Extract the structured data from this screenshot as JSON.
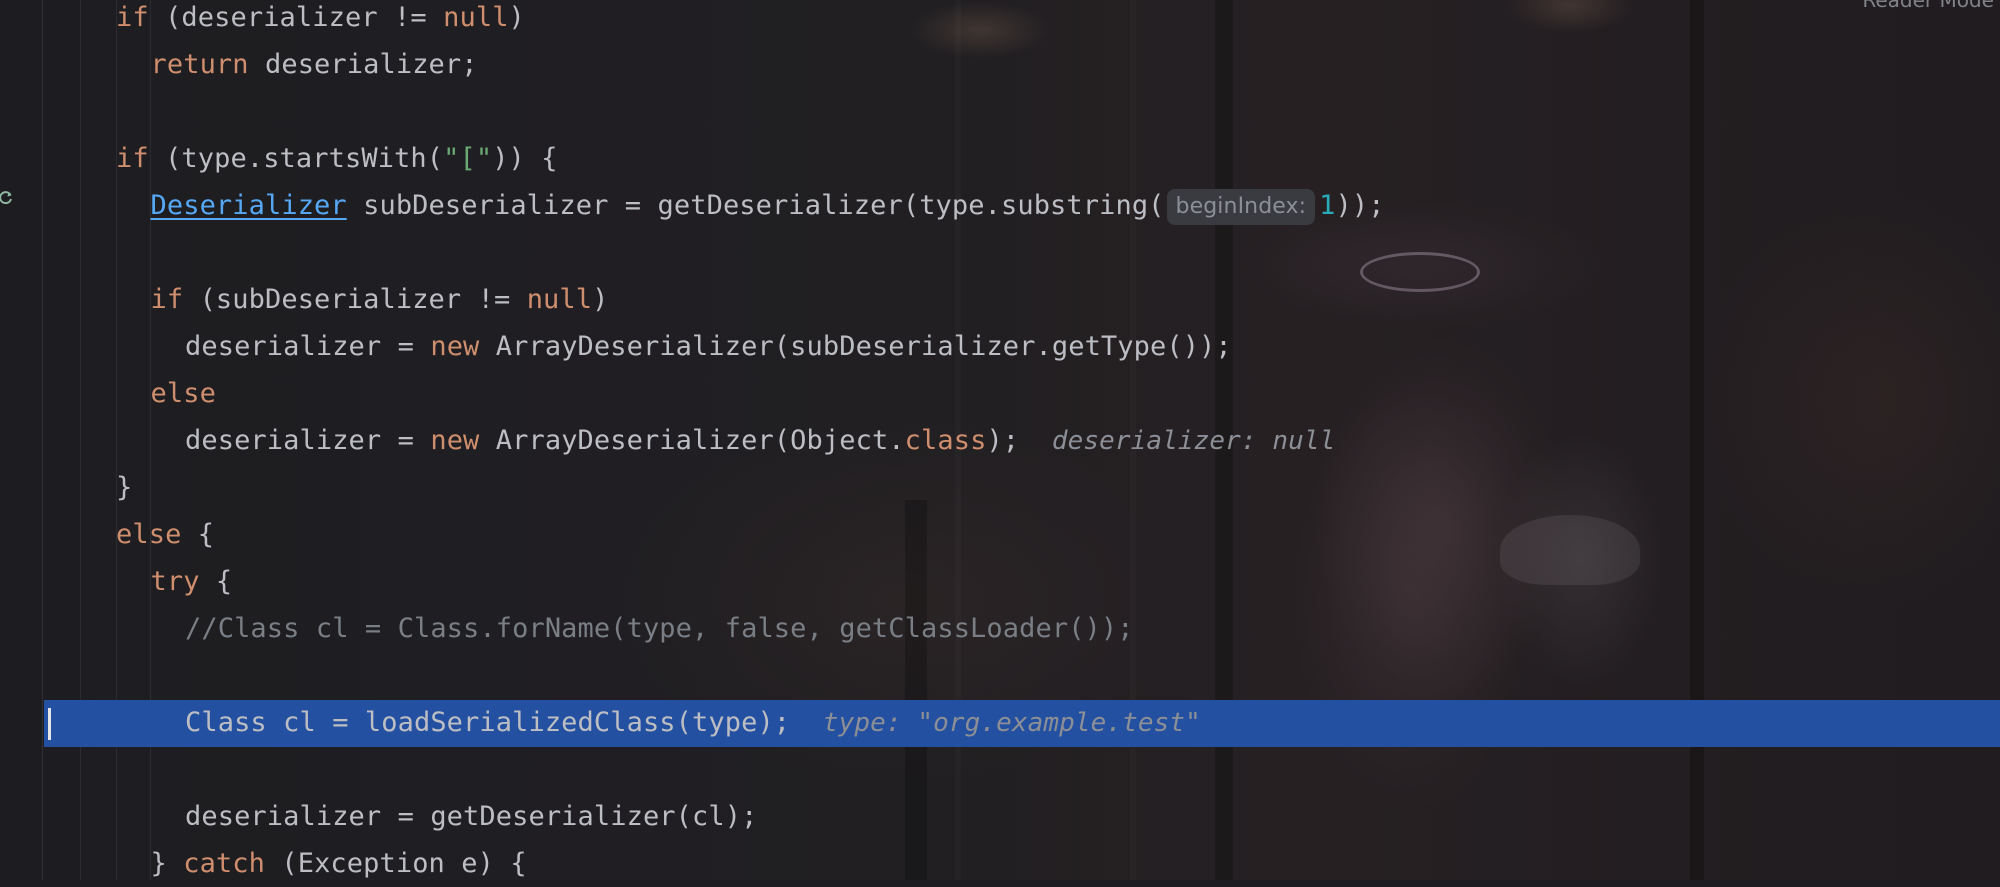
{
  "editor": {
    "corner_text": "Reader Mode",
    "lines": [
      {
        "indent": 0,
        "parts": [
          [
            "kw",
            "if"
          ],
          [
            "txt",
            " (deserializer != "
          ],
          [
            "kw",
            "null"
          ],
          [
            "txt",
            ")"
          ]
        ]
      },
      {
        "indent": 1,
        "parts": [
          [
            "kw",
            "return"
          ],
          [
            "txt",
            " deserializer;"
          ]
        ]
      },
      {
        "indent": 0,
        "parts": []
      },
      {
        "indent": 0,
        "parts": [
          [
            "kw",
            "if"
          ],
          [
            "txt",
            " (type.startsWith("
          ],
          [
            "str",
            "\"[\""
          ],
          [
            "txt",
            ")) {"
          ]
        ]
      },
      {
        "indent": 1,
        "parts": [
          [
            "link",
            "Deserializer"
          ],
          [
            "txt",
            " subDeserializer = getDeserializer(type.substring("
          ],
          [
            "hint",
            "beginIndex:"
          ],
          [
            "num",
            "1"
          ],
          [
            "txt",
            "));"
          ]
        ]
      },
      {
        "indent": 0,
        "parts": []
      },
      {
        "indent": 1,
        "parts": [
          [
            "kw",
            "if"
          ],
          [
            "txt",
            " (subDeserializer != "
          ],
          [
            "kw",
            "null"
          ],
          [
            "txt",
            ")"
          ]
        ]
      },
      {
        "indent": 2,
        "parts": [
          [
            "txt",
            "deserializer = "
          ],
          [
            "kw",
            "new"
          ],
          [
            "txt",
            " ArrayDeserializer(subDeserializer.getType());"
          ]
        ]
      },
      {
        "indent": 1,
        "parts": [
          [
            "kw",
            "else"
          ]
        ]
      },
      {
        "indent": 2,
        "parts": [
          [
            "txt",
            "deserializer = "
          ],
          [
            "kw",
            "new"
          ],
          [
            "txt",
            " ArrayDeserializer(Object."
          ],
          [
            "kw",
            "class"
          ],
          [
            "txt",
            ");  "
          ],
          [
            "val",
            "deserializer: null"
          ]
        ]
      },
      {
        "indent": 0,
        "parts": [
          [
            "txt",
            "}"
          ]
        ]
      },
      {
        "indent": 0,
        "parts": [
          [
            "kw",
            "else"
          ],
          [
            "txt",
            " {"
          ]
        ]
      },
      {
        "indent": 1,
        "parts": [
          [
            "kw",
            "try"
          ],
          [
            "txt",
            " {"
          ]
        ]
      },
      {
        "indent": 2,
        "parts": [
          [
            "cm",
            "//Class cl = Class.forName(type, false, getClassLoader());"
          ]
        ]
      },
      {
        "indent": 0,
        "parts": []
      },
      {
        "indent": 2,
        "parts": [
          [
            "txt",
            "Class cl = loadSerializedClass(type);  "
          ],
          [
            "val",
            "type: \"org.example.test\""
          ]
        ]
      },
      {
        "indent": 0,
        "parts": []
      },
      {
        "indent": 2,
        "parts": [
          [
            "txt",
            "deserializer = getDeserializer(cl);"
          ]
        ]
      },
      {
        "indent": 1,
        "parts": [
          [
            "txt",
            "} "
          ],
          [
            "kw",
            "catch"
          ],
          [
            "txt",
            " (Exception e) {"
          ]
        ]
      }
    ]
  },
  "icons": {
    "gutter": "reload-icon"
  },
  "colors": {
    "keyword": "#cf8e6d",
    "string": "#6aab73",
    "number": "#2aacb8",
    "comment": "#7a7e85",
    "link": "#56a8f5",
    "execution_line": "#2350a0"
  }
}
